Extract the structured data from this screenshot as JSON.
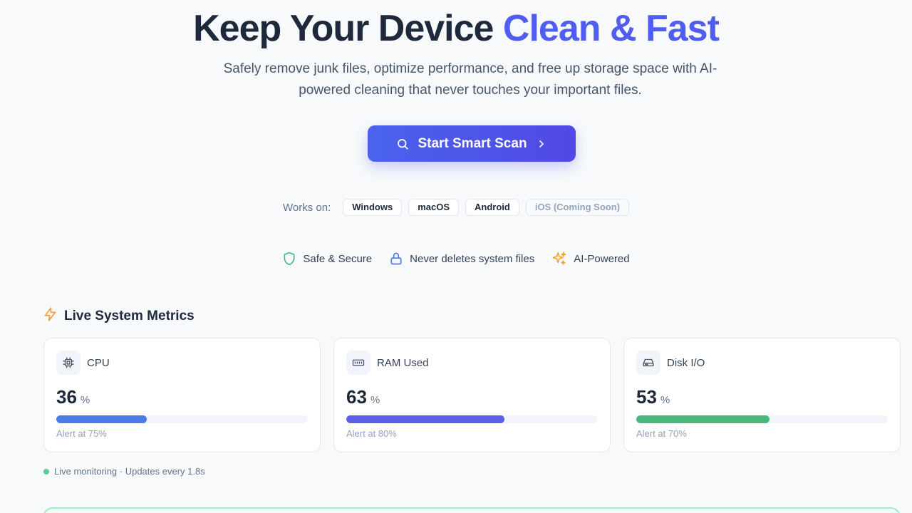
{
  "hero": {
    "title_main": "Keep Your Device ",
    "title_accent": "Clean & Fast",
    "subtitle": "Safely remove junk files, optimize performance, and free up storage space with AI-powered cleaning that never touches your important files.",
    "cta_label": "Start Smart Scan"
  },
  "works_on": {
    "label": "Works on:",
    "platforms": [
      "Windows",
      "macOS",
      "Android",
      "iOS (Coming Soon)"
    ]
  },
  "features": [
    {
      "label": "Safe & Secure",
      "icon": "shield-icon",
      "color": "#3fbf7f"
    },
    {
      "label": "Never deletes system files",
      "icon": "lock-icon",
      "color": "#4a7be0"
    },
    {
      "label": "AI-Powered",
      "icon": "sparkles-icon",
      "color": "#f2a33a"
    }
  ],
  "metrics": {
    "title": "Live System Metrics",
    "items": [
      {
        "name": "CPU",
        "value": "36",
        "unit": "%",
        "percent": 36,
        "alert": "Alert at 75%",
        "color": "#4a7be9",
        "icon": "cpu-icon"
      },
      {
        "name": "RAM Used",
        "value": "63",
        "unit": "%",
        "percent": 63,
        "alert": "Alert at 80%",
        "color": "#5b5fe6",
        "icon": "memory-icon"
      },
      {
        "name": "Disk I/O",
        "value": "53",
        "unit": "%",
        "percent": 53,
        "alert": "Alert at 70%",
        "color": "#45b87c",
        "icon": "hard-drive-icon"
      }
    ],
    "live_text": "Live monitoring · Updates every 1.8s"
  },
  "colors": {
    "accent": "#4f5ef0",
    "success": "#5ccd93"
  }
}
